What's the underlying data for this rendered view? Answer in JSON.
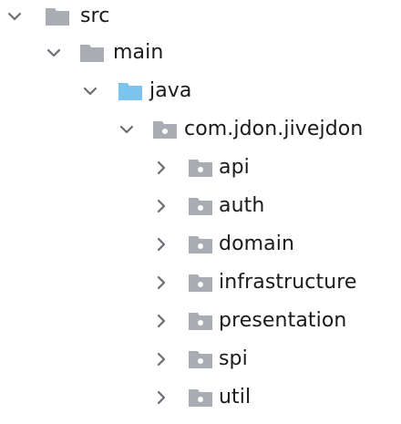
{
  "tree": {
    "colors": {
      "folder_default": "#a9adb3",
      "folder_source": "#7cc3ee",
      "arrow": "#6b6e73",
      "package_dot": "#ffffff"
    },
    "nodes": [
      {
        "label": "src",
        "expanded": true,
        "icon": "folder-icon"
      },
      {
        "label": "main",
        "expanded": true,
        "icon": "folder-icon"
      },
      {
        "label": "java",
        "expanded": true,
        "icon": "source-folder-icon"
      },
      {
        "label": "com.jdon.jivejdon",
        "expanded": true,
        "icon": "package-folder-icon"
      },
      {
        "label": "api",
        "expanded": false,
        "icon": "package-folder-icon"
      },
      {
        "label": "auth",
        "expanded": false,
        "icon": "package-folder-icon"
      },
      {
        "label": "domain",
        "expanded": false,
        "icon": "package-folder-icon"
      },
      {
        "label": "infrastructure",
        "expanded": false,
        "icon": "package-folder-icon"
      },
      {
        "label": "presentation",
        "expanded": false,
        "icon": "package-folder-icon"
      },
      {
        "label": "spi",
        "expanded": false,
        "icon": "package-folder-icon"
      },
      {
        "label": "util",
        "expanded": false,
        "icon": "package-folder-icon"
      }
    ]
  }
}
